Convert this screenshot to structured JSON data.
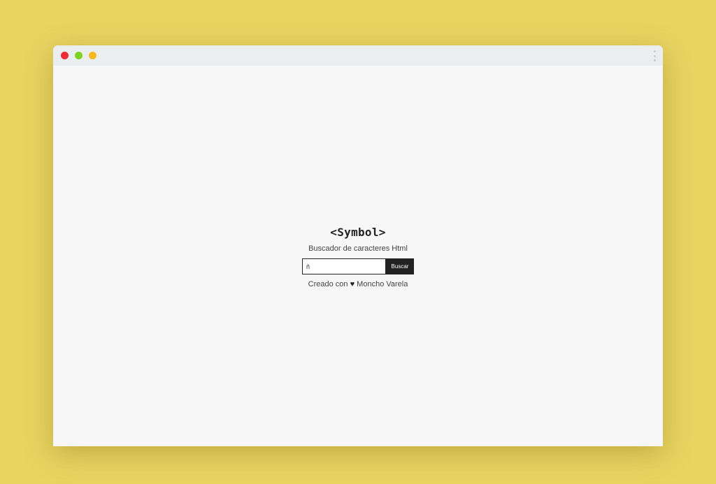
{
  "window": {
    "controls": [
      "close",
      "minimize",
      "maximize"
    ],
    "menu_icon": "kebab-menu-icon"
  },
  "app": {
    "logo": "<Symbol>",
    "subtitle": "Buscador de caracteres Html"
  },
  "search": {
    "value": "ñ",
    "button_label": "Buscar"
  },
  "credit": {
    "prefix": "Creado con",
    "icon": "heart-icon",
    "heart_glyph": "♥",
    "author": "Moncho Varela"
  },
  "colors": {
    "background": "#e8d461",
    "window": "#f7f7f7",
    "titlebar": "#ebeeee",
    "close_dot": "#f12b35",
    "minimize_dot": "#7ed321",
    "maximize_dot": "#f7b81b",
    "button": "#222222"
  }
}
